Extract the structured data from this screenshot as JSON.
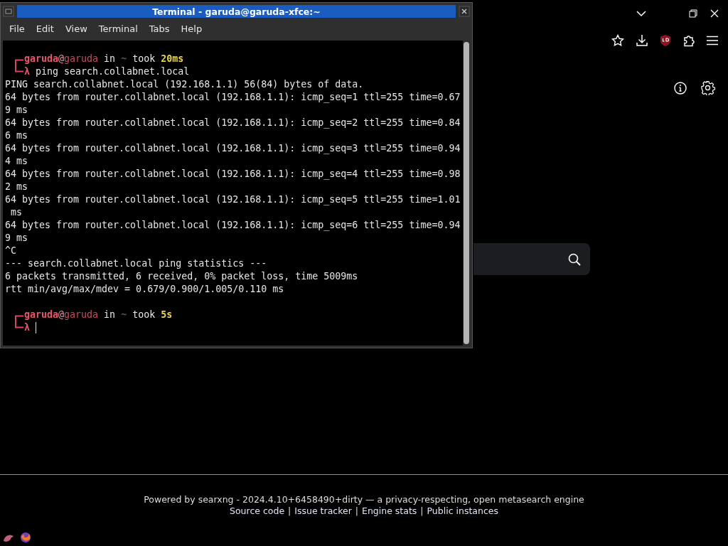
{
  "terminal": {
    "title": "Terminal - garuda@garuda-xfce:~",
    "menu": [
      "File",
      "Edit",
      "View",
      "Terminal",
      "Tabs",
      "Help"
    ],
    "lines": [
      {
        "kind": "prompt",
        "user": "garuda",
        "at": "@",
        "host": "garuda",
        "in": "in",
        "dir": "~",
        "took": "took",
        "duration": "20ms"
      },
      {
        "kind": "command",
        "symbol": "λ",
        "text": "ping search.collabnet.local"
      },
      {
        "kind": "output",
        "text": "PING search.collabnet.local (192.168.1.1) 56(84) bytes of data."
      },
      {
        "kind": "output",
        "text": "64 bytes from router.collabnet.local (192.168.1.1): icmp_seq=1 ttl=255 time=0.67"
      },
      {
        "kind": "output",
        "text": "9 ms"
      },
      {
        "kind": "output",
        "text": "64 bytes from router.collabnet.local (192.168.1.1): icmp_seq=2 ttl=255 time=0.84"
      },
      {
        "kind": "output",
        "text": "6 ms"
      },
      {
        "kind": "output",
        "text": "64 bytes from router.collabnet.local (192.168.1.1): icmp_seq=3 ttl=255 time=0.94"
      },
      {
        "kind": "output",
        "text": "4 ms"
      },
      {
        "kind": "output",
        "text": "64 bytes from router.collabnet.local (192.168.1.1): icmp_seq=4 ttl=255 time=0.98"
      },
      {
        "kind": "output",
        "text": "2 ms"
      },
      {
        "kind": "output",
        "text": "64 bytes from router.collabnet.local (192.168.1.1): icmp_seq=5 ttl=255 time=1.01"
      },
      {
        "kind": "output",
        "text": " ms"
      },
      {
        "kind": "output",
        "text": "64 bytes from router.collabnet.local (192.168.1.1): icmp_seq=6 ttl=255 time=0.94"
      },
      {
        "kind": "output",
        "text": "9 ms"
      },
      {
        "kind": "output",
        "text": "^C"
      },
      {
        "kind": "output",
        "text": "--- search.collabnet.local ping statistics ---"
      },
      {
        "kind": "output",
        "text": "6 packets transmitted, 6 received, 0% packet loss, time 5009ms"
      },
      {
        "kind": "output",
        "text": "rtt min/avg/max/mdev = 0.679/0.900/1.005/0.110 ms"
      },
      {
        "kind": "blank"
      },
      {
        "kind": "prompt",
        "user": "garuda",
        "at": "@",
        "host": "garuda",
        "in": "in",
        "dir": "~",
        "took": "took",
        "duration": "5s"
      },
      {
        "kind": "input",
        "symbol": "λ",
        "cursor": true
      }
    ]
  },
  "footer": {
    "powered_by": "Powered by searxng - 2024.4.10+6458490+dirty — a privacy-respecting, open metasearch engine",
    "links": [
      {
        "kind": "link",
        "text": "Source code"
      },
      {
        "kind": "separator",
        "text": "|"
      },
      {
        "kind": "link",
        "text": "Issue tracker"
      },
      {
        "kind": "separator",
        "text": "|"
      },
      {
        "kind": "link",
        "text": "Engine stats"
      },
      {
        "kind": "separator",
        "text": "|"
      },
      {
        "kind": "link",
        "text": "Public instances"
      }
    ]
  }
}
